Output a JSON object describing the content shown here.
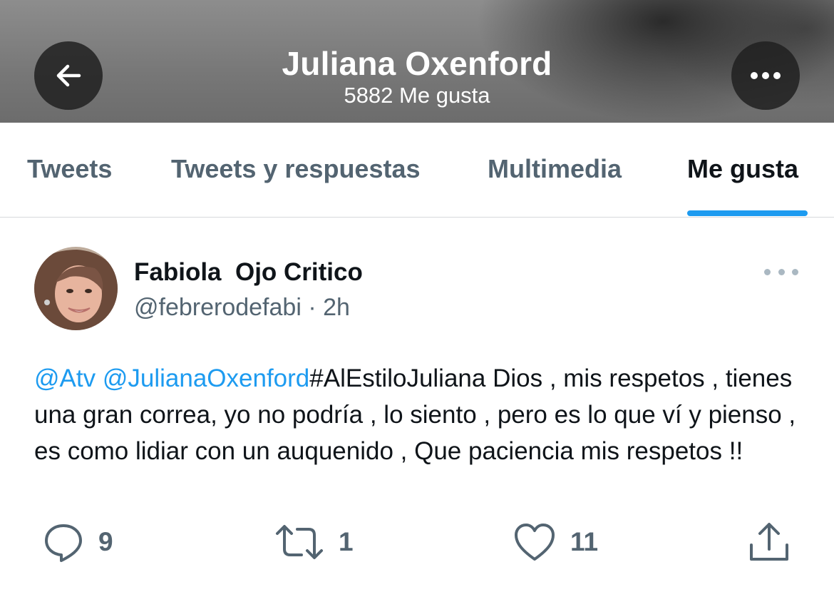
{
  "header": {
    "title": "Juliana Oxenford",
    "subtitle": "5882 Me gusta",
    "back_icon": "arrow-left-icon",
    "more_icon": "more-horizontal-icon"
  },
  "tabs": [
    {
      "label": "Tweets",
      "active": false
    },
    {
      "label": "Tweets y respuestas",
      "active": false
    },
    {
      "label": "Multimedia",
      "active": false
    },
    {
      "label": "Me gusta",
      "active": true
    }
  ],
  "colors": {
    "accent": "#1d9bf0",
    "text_primary": "#0f1419",
    "text_secondary": "#536471"
  },
  "tweet": {
    "author_name": "Fabiola  Ojo Critico",
    "handle": "@febrerodefabi",
    "separator": " · ",
    "time": "2h",
    "mention_1": "@Atv",
    "mention_2": "@JulianaOxenford",
    "body": "#AlEstiloJuliana Dios , mis respetos , tienes una gran correa, yo no podría , lo siento , pero es lo que ví y pienso , es como lidiar con un auquenido , Que paciencia mis respetos !!",
    "replies": "9",
    "retweets": "1",
    "likes": "11"
  }
}
